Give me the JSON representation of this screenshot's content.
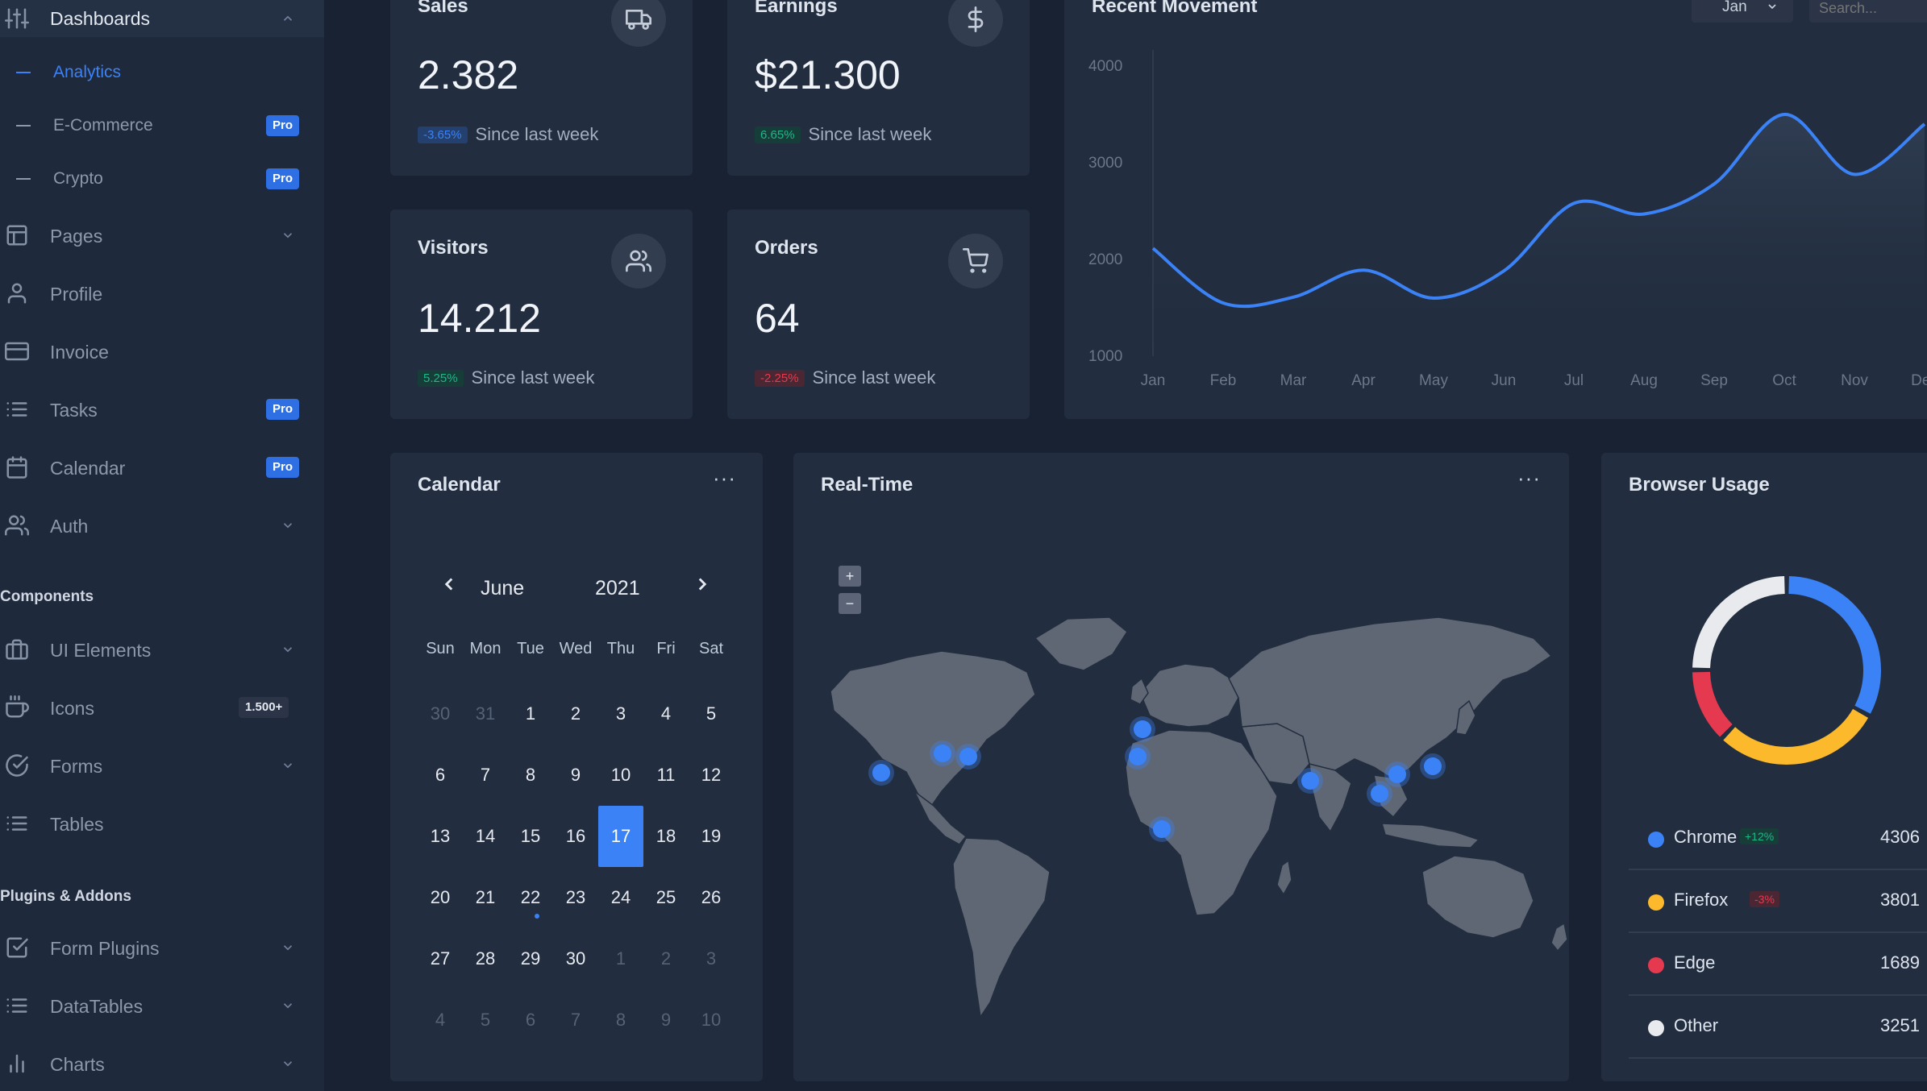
{
  "sidebar": {
    "dashboards": {
      "label": "Dashboards"
    },
    "sub_items": [
      {
        "label": "Analytics",
        "active": true,
        "badge": ""
      },
      {
        "label": "E-Commerce",
        "active": false,
        "badge": "Pro"
      },
      {
        "label": "Crypto",
        "active": false,
        "badge": "Pro"
      }
    ],
    "items": [
      {
        "label": "Pages",
        "icon": "layout-icon",
        "badge": "",
        "chevron": true
      },
      {
        "label": "Profile",
        "icon": "user-icon",
        "badge": "",
        "chevron": false
      },
      {
        "label": "Invoice",
        "icon": "credit-card-icon",
        "badge": "",
        "chevron": false
      },
      {
        "label": "Tasks",
        "icon": "list-icon",
        "badge": "Pro",
        "chevron": false
      },
      {
        "label": "Calendar",
        "icon": "calendar-icon",
        "badge": "Pro",
        "chevron": false
      },
      {
        "label": "Auth",
        "icon": "users-icon",
        "badge": "",
        "chevron": true
      }
    ],
    "section_components": "Components",
    "components": [
      {
        "label": "UI Elements",
        "icon": "briefcase-icon",
        "badge": "",
        "chevron": true
      },
      {
        "label": "Icons",
        "icon": "coffee-icon",
        "badge": "1.500+",
        "chevron": false
      },
      {
        "label": "Forms",
        "icon": "check-circle-icon",
        "badge": "",
        "chevron": true
      },
      {
        "label": "Tables",
        "icon": "list-icon",
        "badge": "",
        "chevron": false
      }
    ],
    "section_plugins": "Plugins & Addons",
    "plugins": [
      {
        "label": "Form Plugins",
        "icon": "check-square-icon",
        "badge": "",
        "chevron": true
      },
      {
        "label": "DataTables",
        "icon": "list-icon",
        "badge": "",
        "chevron": true
      },
      {
        "label": "Charts",
        "icon": "bar-chart-icon",
        "badge": "",
        "chevron": true
      }
    ]
  },
  "stats": {
    "sales": {
      "title": "Sales",
      "value": "2.382",
      "change": "-3.65%",
      "since": "Since last week",
      "icon": "truck-icon"
    },
    "earnings": {
      "title": "Earnings",
      "value": "$21.300",
      "change": "6.65%",
      "since": "Since last week",
      "icon": "dollar-icon"
    },
    "visitors": {
      "title": "Visitors",
      "value": "14.212",
      "change": "5.25%",
      "since": "Since last week",
      "icon": "users-icon"
    },
    "orders": {
      "title": "Orders",
      "value": "64",
      "change": "-2.25%",
      "since": "Since last week",
      "icon": "shopping-cart-icon"
    }
  },
  "movement": {
    "title": "Recent Movement",
    "select_value": "Jan",
    "search_placeholder": "Search..."
  },
  "chart_data": {
    "type": "line",
    "title": "Recent Movement",
    "x": [
      "Jan",
      "Feb",
      "Mar",
      "Apr",
      "May",
      "Jun",
      "Jul",
      "Aug",
      "Sep",
      "Oct",
      "Nov",
      "Dec"
    ],
    "yticks": [
      1000,
      2000,
      3000,
      4000
    ],
    "ylim": [
      1000,
      4000
    ],
    "grid": false,
    "series": [
      {
        "values": [
          2115,
          1550,
          1610,
          1890,
          1600,
          1880,
          2580,
          2470,
          2780,
          3500,
          2880,
          3400
        ]
      }
    ]
  },
  "calendar": {
    "title": "Calendar",
    "month": "June",
    "year": "2021",
    "prev_icon": "chevron-left-icon",
    "next_icon": "chevron-right-icon",
    "dow": [
      "Sun",
      "Mon",
      "Tue",
      "Wed",
      "Thu",
      "Fri",
      "Sat"
    ],
    "weeks": [
      [
        {
          "d": "30",
          "m": true
        },
        {
          "d": "31",
          "m": true
        },
        {
          "d": "1"
        },
        {
          "d": "2"
        },
        {
          "d": "3"
        },
        {
          "d": "4"
        },
        {
          "d": "5"
        }
      ],
      [
        {
          "d": "6"
        },
        {
          "d": "7"
        },
        {
          "d": "8"
        },
        {
          "d": "9"
        },
        {
          "d": "10"
        },
        {
          "d": "11"
        },
        {
          "d": "12"
        }
      ],
      [
        {
          "d": "13"
        },
        {
          "d": "14"
        },
        {
          "d": "15"
        },
        {
          "d": "16"
        },
        {
          "d": "17",
          "s": true
        },
        {
          "d": "18"
        },
        {
          "d": "19"
        }
      ],
      [
        {
          "d": "20"
        },
        {
          "d": "21"
        },
        {
          "d": "22",
          "e": true
        },
        {
          "d": "23"
        },
        {
          "d": "24"
        },
        {
          "d": "25"
        },
        {
          "d": "26"
        }
      ],
      [
        {
          "d": "27"
        },
        {
          "d": "28"
        },
        {
          "d": "29"
        },
        {
          "d": "30"
        },
        {
          "d": "1",
          "m": true
        },
        {
          "d": "2",
          "m": true
        },
        {
          "d": "3",
          "m": true
        }
      ],
      [
        {
          "d": "4",
          "m": true
        },
        {
          "d": "5",
          "m": true
        },
        {
          "d": "6",
          "m": true
        },
        {
          "d": "7",
          "m": true
        },
        {
          "d": "8",
          "m": true
        },
        {
          "d": "9",
          "m": true
        },
        {
          "d": "10",
          "m": true
        }
      ]
    ]
  },
  "realtime": {
    "title": "Real-Time",
    "zoom_in": "+",
    "zoom_out": "−"
  },
  "browser": {
    "title": "Browser Usage",
    "items": [
      {
        "name": "Chrome",
        "chip": "+12%",
        "chip_kind": "green",
        "value": "4306",
        "color": "#3b82f6",
        "share": 4306
      },
      {
        "name": "Firefox",
        "chip": "-3%",
        "chip_kind": "red",
        "value": "3801",
        "color": "#fcb92c",
        "share": 3801
      },
      {
        "name": "Edge",
        "chip": "",
        "chip_kind": "",
        "value": "1689",
        "color": "#e5394f",
        "share": 1689
      },
      {
        "name": "Other",
        "chip": "",
        "chip_kind": "",
        "value": "3251",
        "color": "#e8eaed",
        "share": 3251
      }
    ]
  },
  "colors": {
    "accent": "#3b82f6",
    "card": "#222e3f",
    "background": "#192233"
  }
}
